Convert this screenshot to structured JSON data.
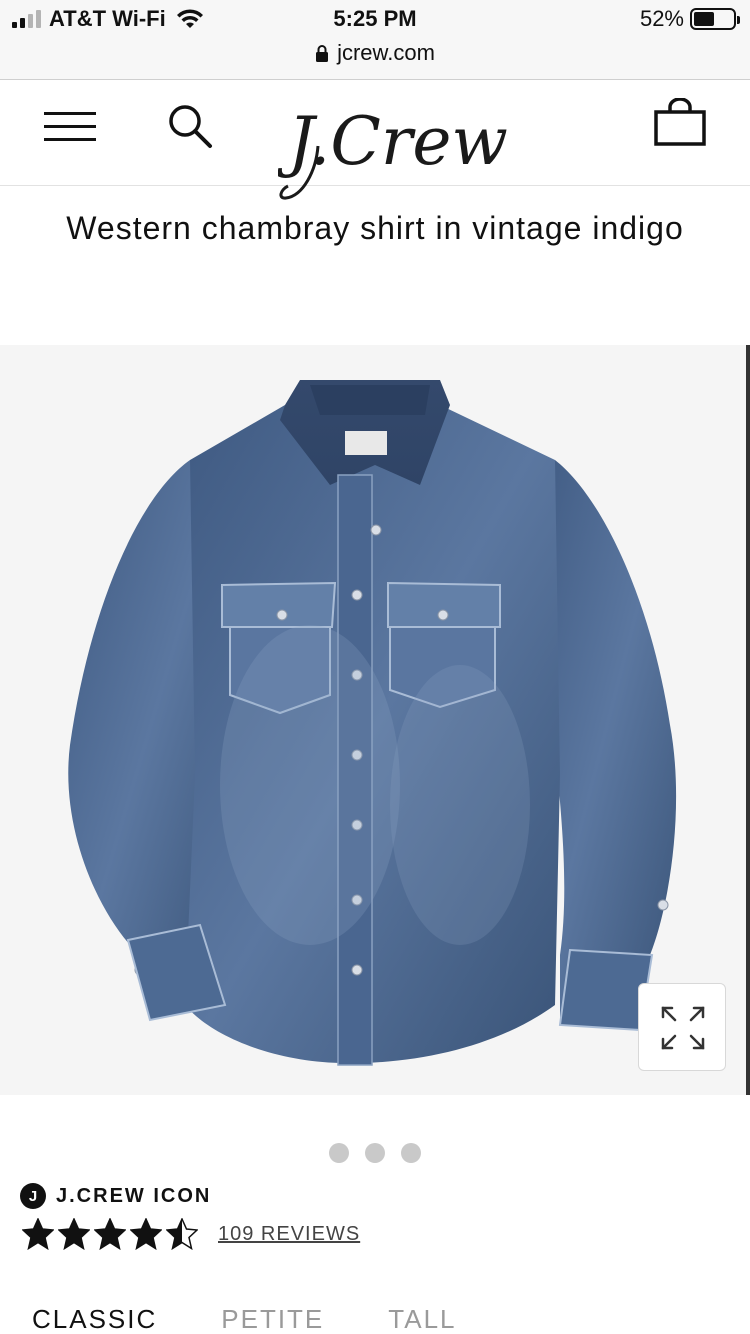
{
  "status_bar": {
    "carrier": "AT&T Wi-Fi",
    "time": "5:25 PM",
    "battery_percent": "52%",
    "battery_level": 0.52,
    "signal_bars_filled": 2,
    "signal_bars_total": 4
  },
  "browser": {
    "url": "jcrew.com"
  },
  "header": {
    "logo_text": "J.Crew",
    "icons": [
      "menu-icon",
      "search-icon",
      "shopping-bag-icon"
    ]
  },
  "product": {
    "title": "Western chambray shirt in vintage indigo",
    "image_count": 3,
    "brand_badge": "J",
    "brand_label": "J.CREW ICON",
    "rating": 4.5,
    "reviews_label": "109 REVIEWS",
    "fit_tabs": [
      {
        "label": "CLASSIC",
        "selected": true
      },
      {
        "label": "PETITE",
        "selected": false
      },
      {
        "label": "TALL",
        "selected": false
      }
    ]
  },
  "colors": {
    "status_bg": "#f7f7f7",
    "text": "#111111",
    "image_bg": "#f5f5f5",
    "denim": "#45618a",
    "inactive_tab": "#9a9a9a"
  }
}
